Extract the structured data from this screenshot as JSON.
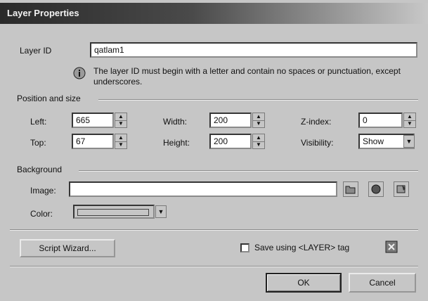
{
  "window": {
    "title": "Layer Properties"
  },
  "layer_id": {
    "label": "Layer ID",
    "value": "qatlam1"
  },
  "info": {
    "text": "The layer ID must begin with a letter and contain no spaces or punctuation, except underscores."
  },
  "position": {
    "heading": "Position and size",
    "left": {
      "label": "Left:",
      "value": "665"
    },
    "top": {
      "label": "Top:",
      "value": "67"
    },
    "width": {
      "label": "Width:",
      "value": "200"
    },
    "height": {
      "label": "Height:",
      "value": "200"
    },
    "zindex": {
      "label": "Z-index:",
      "value": "0"
    },
    "visibility": {
      "label": "Visibility:",
      "value": "Show"
    }
  },
  "background": {
    "heading": "Background",
    "image_label": "Image:",
    "image_value": "",
    "color_label": "Color:"
  },
  "buttons": {
    "script_wizard": "Script Wizard...",
    "save_layer_tag": "Save using <LAYER> tag",
    "ok": "OK",
    "cancel": "Cancel"
  },
  "icons": {
    "info": "info-icon",
    "browse": "folder-icon",
    "picker": "eyedropper-icon",
    "edit": "edit-image-icon",
    "help": "help-icon"
  }
}
